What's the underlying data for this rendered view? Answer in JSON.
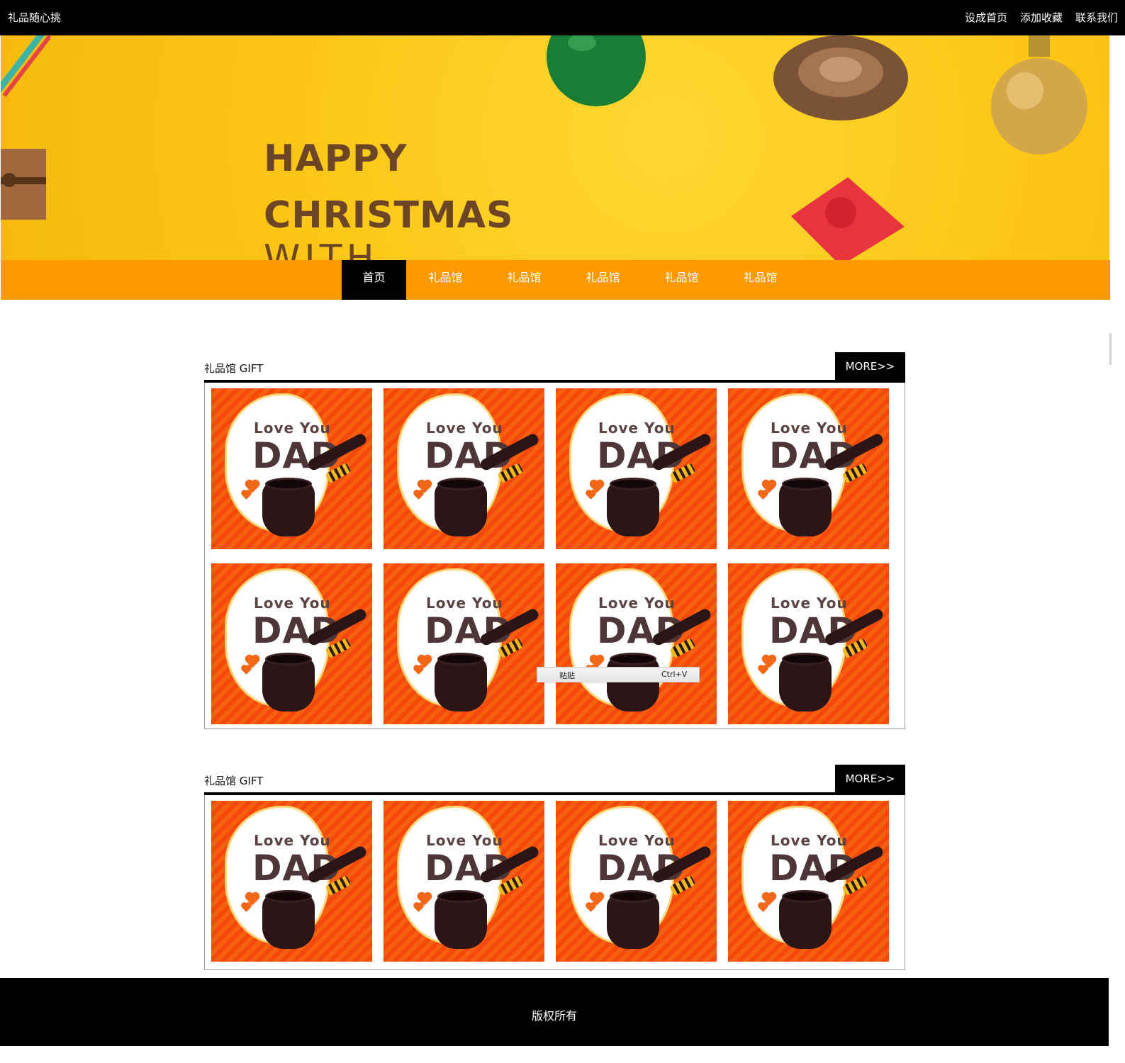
{
  "header": {
    "site_name": "礼品随心挑",
    "links": [
      "设成首页",
      "添加收藏",
      "联系我们"
    ]
  },
  "banner": {
    "line1": "HAPPY",
    "line2": "CHRISTMAS",
    "line3": "WITH"
  },
  "nav": {
    "items": [
      "首页",
      "礼品馆",
      "礼品馆",
      "礼品馆",
      "礼品馆",
      "礼品馆"
    ],
    "active_index": 0
  },
  "sections": [
    {
      "title": "礼品馆 GIFT",
      "more": "MORE>>",
      "item_count": 8
    },
    {
      "title": "礼品馆 GIFT",
      "more": "MORE>>",
      "item_count": 4
    }
  ],
  "product": {
    "line1": "Love You",
    "line2": "DAD"
  },
  "context_menu": {
    "label": "粘贴",
    "shortcut": "Ctrl+V"
  },
  "footer": {
    "text": "版权所有"
  },
  "colors": {
    "nav_bg": "#fe9a00",
    "banner_bg": "#fcc615",
    "top_bg": "#000000",
    "banner_text": "#6b4526"
  }
}
